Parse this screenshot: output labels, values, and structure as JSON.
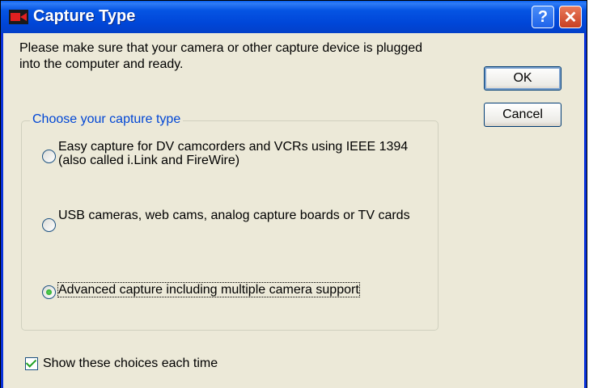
{
  "window": {
    "title": "Capture Type",
    "help_symbol": "?",
    "close_symbol": "✕"
  },
  "intro_text": "Please make sure that your camera or other capture device is plugged into the computer and ready.",
  "buttons": {
    "ok_label": "OK",
    "cancel_label": "Cancel"
  },
  "group": {
    "label": "Choose your capture type",
    "options": [
      {
        "label": "Easy capture for DV camcorders and VCRs using IEEE 1394 (also called i.Link and FireWire)",
        "selected": false
      },
      {
        "label": "USB cameras, web cams, analog capture boards or TV cards",
        "selected": false
      },
      {
        "label": "Advanced capture including multiple camera support",
        "selected": true
      }
    ]
  },
  "show_choices": {
    "label": "Show these choices each time",
    "checked": true
  },
  "colors": {
    "titlebar": "#0554e3",
    "group_label": "#0046d5",
    "dialog_bg": "#ece9d8"
  },
  "icons": {
    "title": "video-camera-icon"
  }
}
